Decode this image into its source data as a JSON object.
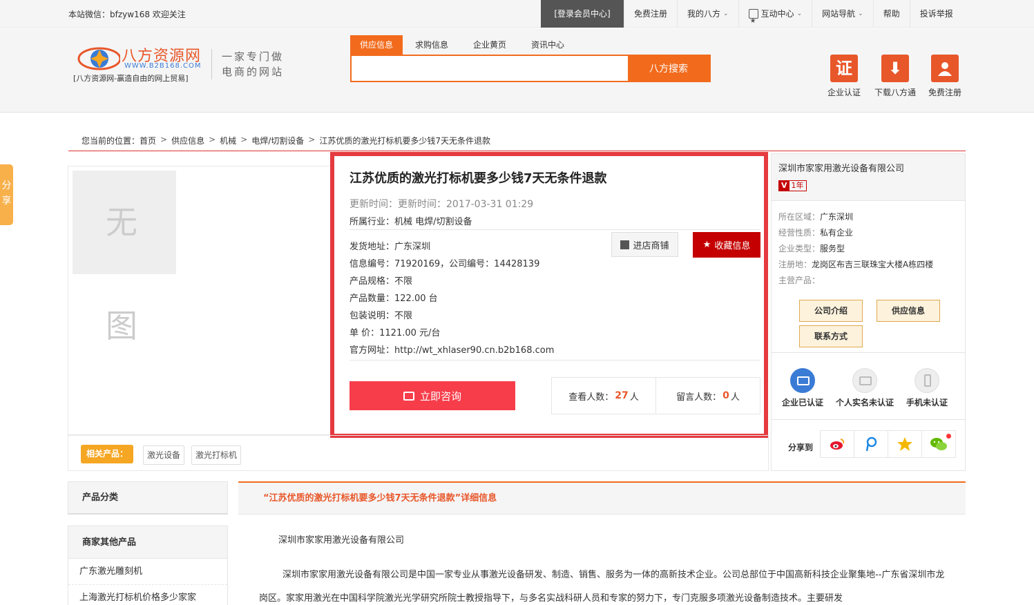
{
  "topbar": {
    "welcome": "本站微信：bfzyw168 欢迎关注",
    "nav": [
      {
        "label": "[登录会员中心]",
        "dropdown": false
      },
      {
        "label": "免费注册",
        "dropdown": false
      },
      {
        "label": "我的八方",
        "dropdown": true
      },
      {
        "label": "互动中心",
        "dropdown": true
      },
      {
        "label": "网站导航",
        "dropdown": true
      },
      {
        "label": "帮助",
        "dropdown": false
      },
      {
        "label": "投诉举报",
        "dropdown": false
      }
    ]
  },
  "header": {
    "logo_name": "八方资源网",
    "logo_url": "WWW.B2B168.COM",
    "logo_motto": "[八方资源网-赢造自由的网上贸易]",
    "slogan_line1": "一家专门做",
    "slogan_line2": "电商的网站",
    "search_tabs": [
      "供应信息",
      "求购信息",
      "企业黄页",
      "资讯中心"
    ],
    "search_value": "",
    "search_button": "八方搜索",
    "quick_links": [
      {
        "label": "企业认证",
        "icon": "certificate-icon",
        "glyph": "证"
      },
      {
        "label": "下载八方通",
        "icon": "download-icon",
        "glyph": "⬇"
      },
      {
        "label": "免费注册",
        "icon": "user-icon",
        "glyph": "👤"
      }
    ],
    "accent": "#f26b1d"
  },
  "share_tab": {
    "line1": "分",
    "line2": "享"
  },
  "breadcrumb": {
    "prefix": "您当前的位置：",
    "items": [
      "首页",
      "供应信息",
      "机械",
      "电焊/切割设备",
      "江苏优质的激光打标机要多少钱7天无条件退款"
    ]
  },
  "product": {
    "no_image": "无图",
    "title": "江苏优质的激光打标机要多少钱7天无条件退款",
    "updated": "更新时间：更新时间：2017-03-31 01:29",
    "industry": "所属行业：机械 电焊/切割设备",
    "fields": [
      "发货地址：广东深圳",
      "信息编号：71920169，公司编号：14428139",
      "产品规格：不限",
      "产品数量：122.00 台",
      "包装说明：不限",
      "单 价：1121.00 元/台",
      "官方网址：http://wt_xhlaser90.cn.b2b168.com"
    ],
    "shop_button": "进店商铺",
    "fav_button": "收藏信息",
    "consult_button": "立即咨询",
    "views_label": "查看人数：",
    "views": "27",
    "messages_label": "留言人数：",
    "messages": "0",
    "unit": "人",
    "highlight_color": "#e53a3f"
  },
  "related": {
    "label": "相关产品：",
    "tags": [
      "激光设备",
      "激光打标机"
    ]
  },
  "company": {
    "name": "深圳市家家用激光设备有限公司",
    "badge_v": "V",
    "badge_years": "1年",
    "info": [
      {
        "k": "所在区域：",
        "v": "广东深圳"
      },
      {
        "k": "经营性质：",
        "v": "私有企业"
      },
      {
        "k": "企业类型：",
        "v": "服务型"
      },
      {
        "k": "注册地：",
        "v": "龙岗区布吉三联珠宝大楼A栋四楼"
      },
      {
        "k": "主营产品：",
        "v": ""
      }
    ],
    "buttons": [
      "公司介绍",
      "供应信息",
      "联系方式"
    ],
    "certs": [
      {
        "label": "企业已认证",
        "on": true
      },
      {
        "label": "个人实名未认证",
        "on": false
      },
      {
        "label": "手机未认证",
        "on": false
      }
    ],
    "share_label": "分享到",
    "share_icons": [
      "weibo-icon",
      "tencent-icon",
      "qzone-icon",
      "wechat-icon"
    ]
  },
  "sidebar": {
    "category_title": "产品分类",
    "other_title": "商家其他产品",
    "other_items": [
      "广东激光雕刻机",
      "上海激光打标机价格多少家家"
    ]
  },
  "main": {
    "detail_header": "“江苏优质的激光打标机要多少钱7天无条件退款”详细信息",
    "company_name": "深圳市家家用激光设备有限公司",
    "paragraph": "深圳市家家用激光设备有限公司是中国一家专业从事激光设备研发、制造、销售、服务为一体的高新技术企业。公司总部位于中国高新科技企业聚集地--广东省深圳市龙岗区。家家用激光在中国科学院激光光学研究所院士教授指导下，与多名实战科研人员和专家的努力下，专门克服多项激光设备制造技术。主要研发"
  }
}
